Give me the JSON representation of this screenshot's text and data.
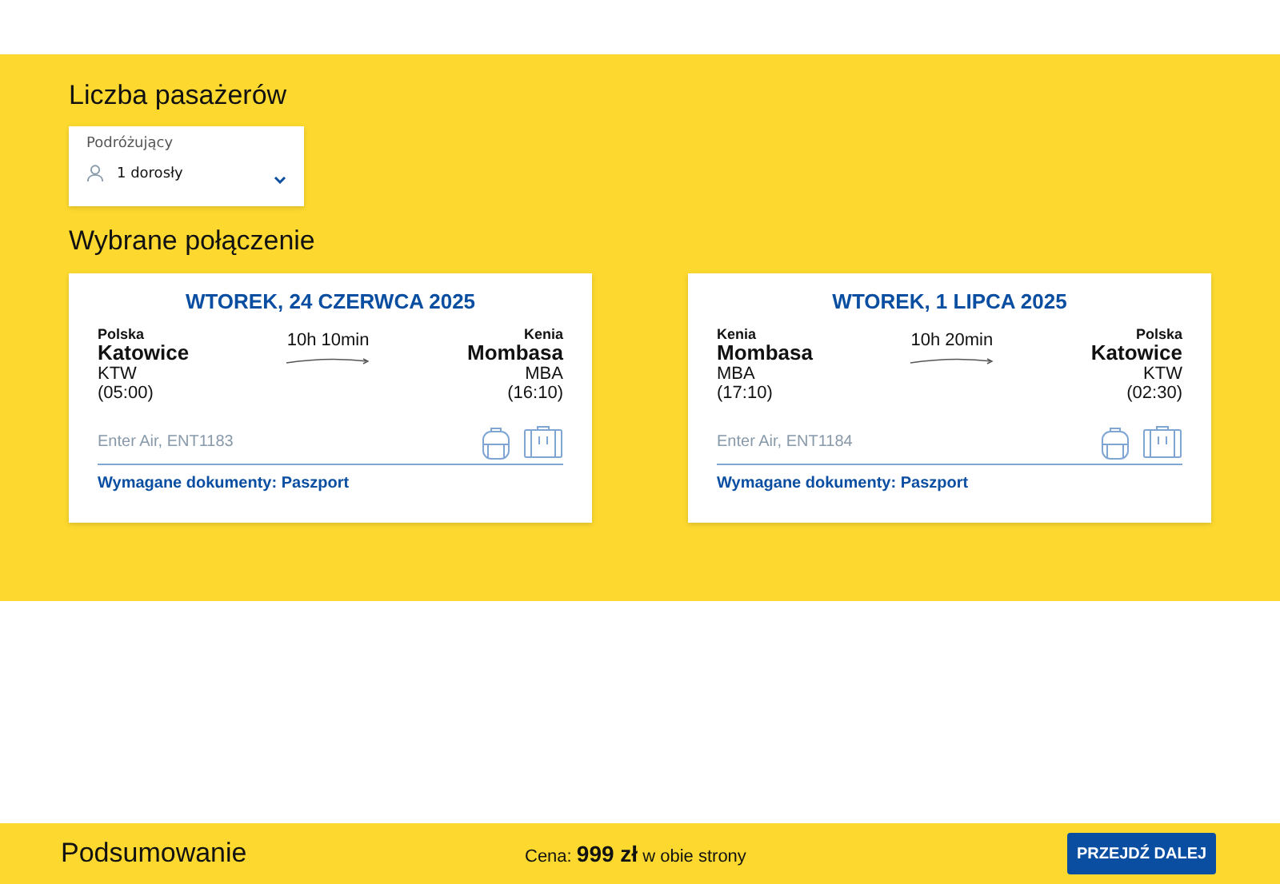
{
  "passengers": {
    "heading": "Liczba pasażerów",
    "field_label": "Podróżujący",
    "value": "1 dorosły"
  },
  "connection": {
    "heading": "Wybrane połączenie",
    "flights": [
      {
        "date": "WTOREK, 24 CZERWCA 2025",
        "from": {
          "country": "Polska",
          "city": "Katowice",
          "code": "KTW",
          "time": "(05:00)"
        },
        "duration": "10h 10min",
        "to": {
          "country": "Kenia",
          "city": "Mombasa",
          "code": "MBA",
          "time": "(16:10)"
        },
        "carrier": "Enter Air, ENT1183",
        "documents": "Wymagane dokumenty: Paszport"
      },
      {
        "date": "WTOREK, 1 LIPCA 2025",
        "from": {
          "country": "Kenia",
          "city": "Mombasa",
          "code": "MBA",
          "time": "(17:10)"
        },
        "duration": "10h 20min",
        "to": {
          "country": "Polska",
          "city": "Katowice",
          "code": "KTW",
          "time": "(02:30)"
        },
        "carrier": "Enter Air, ENT1184",
        "documents": "Wymagane dokumenty: Paszport"
      }
    ]
  },
  "summary": {
    "title": "Podsumowanie",
    "price": "Cena: **999 zł** w obie strony",
    "button": "PRZEJDŹ DALEJ"
  }
}
